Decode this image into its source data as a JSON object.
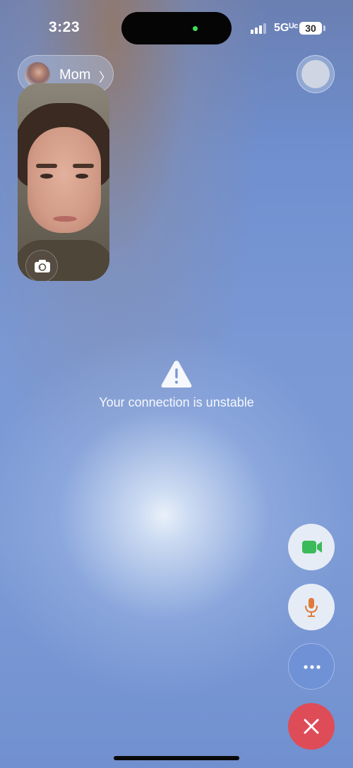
{
  "status_bar": {
    "time": "3:23",
    "network": "5Gᵁᶜ",
    "battery": "30"
  },
  "caller": {
    "name": "Mom",
    "chevron": "〉"
  },
  "warning": {
    "icon": "warning-triangle-icon",
    "message": "Your connection is unstable"
  },
  "controls": {
    "video_icon": "video-camera-icon",
    "mic_icon": "microphone-icon",
    "more_icon": "ellipsis-icon",
    "end_icon": "close-icon"
  },
  "colors": {
    "video_green": "#3cba59",
    "mic_orange": "#e07a3a",
    "end_red": "#de4c58",
    "island_dot": "#3ee05a"
  }
}
